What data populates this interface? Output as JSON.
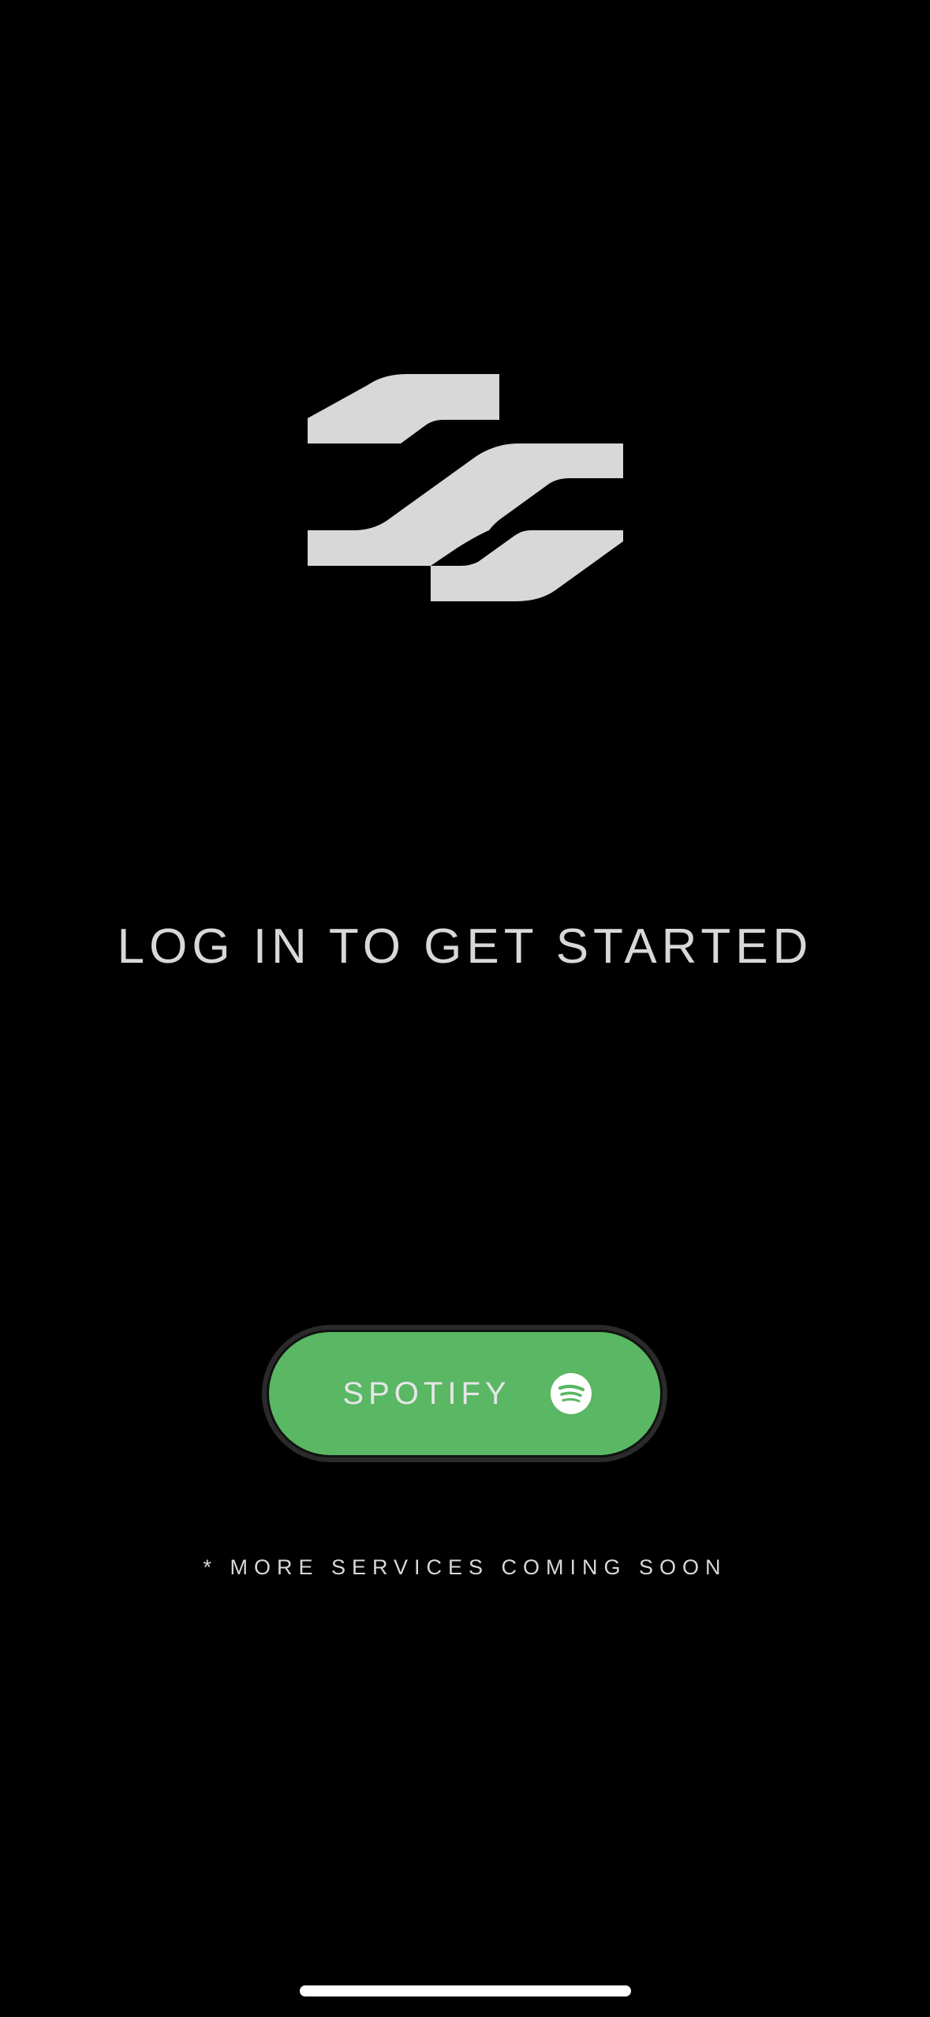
{
  "logo": {
    "icon": "app-logo-icon",
    "color": "#d8d8d8"
  },
  "headline": "LOG IN TO GET STARTED",
  "login_button": {
    "label": "SPOTIFY",
    "icon": "spotify-icon",
    "background": "#5ab764"
  },
  "footnote": "* MORE SERVICES COMING SOON"
}
